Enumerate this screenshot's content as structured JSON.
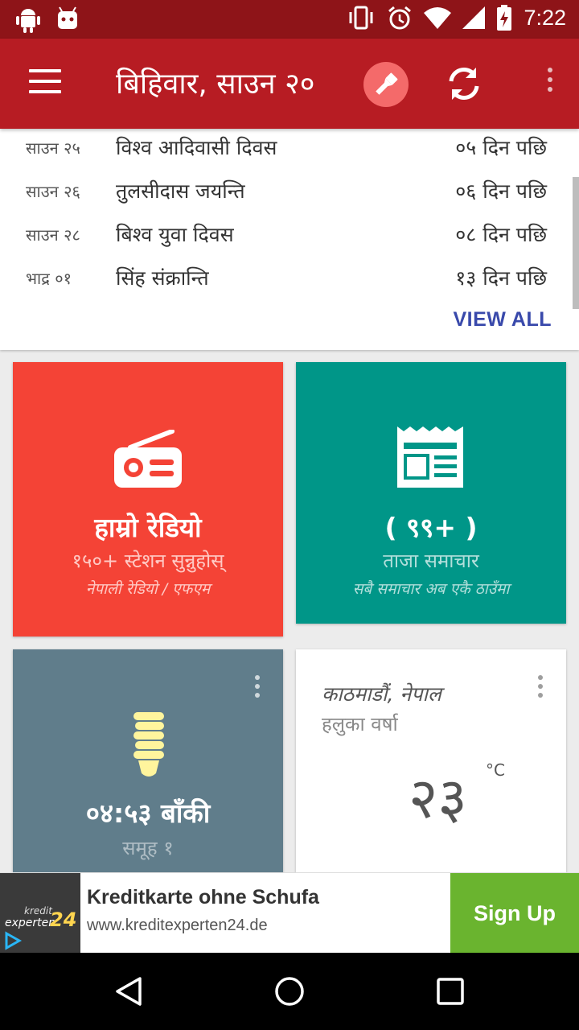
{
  "status_bar": {
    "time": "7:22"
  },
  "app_bar": {
    "title": "बिहिवार, साउन २०"
  },
  "events": [
    {
      "date": "साउन २५",
      "name": "विश्व आदिवासी दिवस",
      "when": "०५ दिन पछि"
    },
    {
      "date": "साउन २६",
      "name": "तुलसीदास जयन्ति",
      "when": "०६ दिन पछि"
    },
    {
      "date": "साउन २८",
      "name": "बिश्व युवा दिवस",
      "when": "०८ दिन पछि"
    },
    {
      "date": "भाद्र ०१",
      "name": "सिंह संक्रान्ति",
      "when": "१३ दिन पछि"
    }
  ],
  "view_all_label": "VIEW ALL",
  "tiles": {
    "radio": {
      "title": "हाम्रो रेडियो",
      "subtitle": "१५०+ स्टेशन सुन्नुहोस्",
      "note": "नेपाली रेडियो / एफएम",
      "color": "#f44336"
    },
    "news": {
      "title": "( ९९+ )",
      "subtitle": "ताजा समाचार",
      "note": "सबै समाचार अब एकै ठाउँमा",
      "color": "#009688"
    },
    "power": {
      "title": "०४:५३ बाँकी",
      "subtitle": "समूह १",
      "color": "#607d8b"
    },
    "weather": {
      "city": "काठमाडौं, नेपाल",
      "condition": "हलुका वर्षा",
      "temperature": "२३",
      "unit": "°C"
    }
  },
  "ad": {
    "logo_line1": "kredit",
    "logo_line2": "experten",
    "logo_line3": "24",
    "headline": "Kreditkarte ohne Schufa",
    "url": "www.kreditexperten24.de",
    "cta": "Sign Up",
    "cta_color": "#6ab42f"
  },
  "colors": {
    "status_bar": "#8e1418",
    "app_bar": "#b71c23",
    "accent": "#3949ab"
  }
}
